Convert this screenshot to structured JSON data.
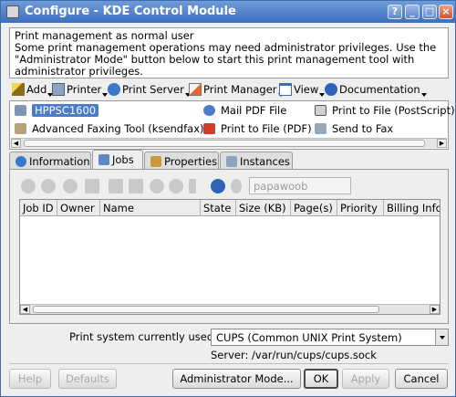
{
  "window": {
    "title": "Configure - KDE Control Module"
  },
  "titlebar_buttons": [
    "?",
    "_",
    "□",
    "×"
  ],
  "message": {
    "line1": "Print management as normal user",
    "line2": "Some print management operations may need administrator privileges. Use the \"Administrator Mode\" button below to start this print management tool with administrator privileges."
  },
  "toolbar": {
    "items": [
      {
        "label": "Add"
      },
      {
        "label": "Printer"
      },
      {
        "label": "Print Server"
      },
      {
        "label": "Print Manager"
      },
      {
        "label": "View"
      },
      {
        "label": "Documentation"
      }
    ]
  },
  "printers": [
    {
      "label": "HPPSC1600",
      "selected": true
    },
    {
      "label": "Mail PDF File"
    },
    {
      "label": "Print to File (PostScript)"
    },
    {
      "label": "Advanced Faxing Tool (ksendfax)"
    },
    {
      "label": "Print to File (PDF)"
    },
    {
      "label": "Send to Fax"
    }
  ],
  "tabs": [
    {
      "label": "Information"
    },
    {
      "label": "Jobs",
      "active": true
    },
    {
      "label": "Properties"
    },
    {
      "label": "Instances"
    }
  ],
  "jobs": {
    "user_placeholder": "papawoob",
    "columns": [
      "Job ID",
      "Owner",
      "Name",
      "State",
      "Size (KB)",
      "Page(s)",
      "Priority",
      "Billing Info"
    ],
    "rows": []
  },
  "print_system": {
    "label": "Print system currently used:",
    "value": "CUPS (Common UNIX Print System)",
    "server": "Server: /var/run/cups/cups.sock"
  },
  "buttons": {
    "help": "Help",
    "defaults": "Defaults",
    "admin": "Administrator Mode...",
    "ok": "OK",
    "apply": "Apply",
    "cancel": "Cancel"
  },
  "colors": {
    "titlebar": "#3d6fc0",
    "selection": "#4a7cc8"
  }
}
